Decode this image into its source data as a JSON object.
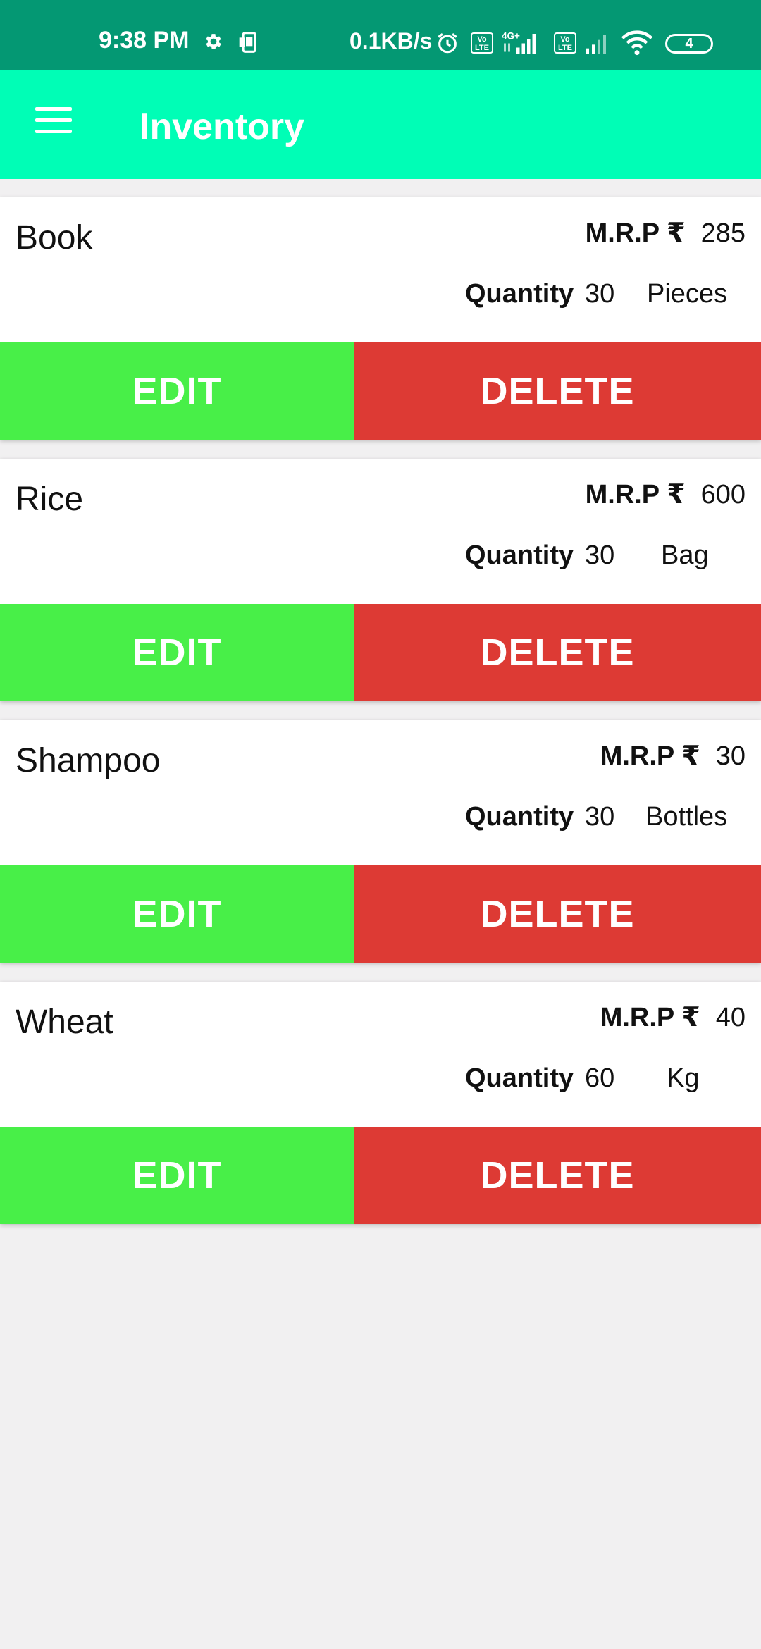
{
  "status_bar": {
    "time": "9:38 PM",
    "speed": "0.1KB/s",
    "network": "4G+",
    "volte": "Vo LTE",
    "battery": "4"
  },
  "app_bar": {
    "title": "Inventory",
    "menu_icon": "menu-icon"
  },
  "colors": {
    "status_bar": "#049873",
    "app_bar": "#00feb6",
    "edit": "#48ef48",
    "delete": "#dd3a34",
    "background": "#f1f0f1"
  },
  "labels": {
    "mrp": "M.R.P",
    "rupee": "₹",
    "quantity": "Quantity",
    "edit": "EDIT",
    "delete": "DELETE"
  },
  "items": [
    {
      "name": "Book",
      "mrp": "285",
      "quantity": "30",
      "unit": "Pieces"
    },
    {
      "name": "Rice",
      "mrp": "600",
      "quantity": "30",
      "unit": "Bag"
    },
    {
      "name": "Shampoo",
      "mrp": "30",
      "quantity": "30",
      "unit": "Bottles"
    },
    {
      "name": "Wheat",
      "mrp": "40",
      "quantity": "60",
      "unit": "Kg"
    }
  ]
}
